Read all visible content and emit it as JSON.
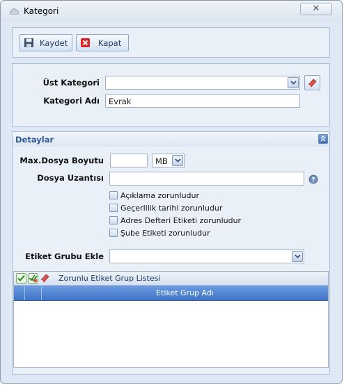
{
  "window": {
    "title": "Kategori",
    "close_glyph": "✕"
  },
  "toolbar": {
    "save_label": "Kaydet",
    "close_label": "Kapat"
  },
  "category": {
    "parent_label": "Üst Kategori",
    "parent_value": "",
    "name_label": "Kategori Adı",
    "name_value": "Evrak"
  },
  "details": {
    "header": "Detaylar",
    "max_size_label": "Max.Dosya Boyutu",
    "max_size_value": "",
    "unit_value": "MB",
    "ext_label": "Dosya Uzantısı",
    "ext_value": "",
    "checkboxes": [
      {
        "label": "Açıklama zorunludur",
        "checked": false
      },
      {
        "label": "Geçerlilik tarihi zorunludur",
        "checked": false
      },
      {
        "label": "Adres Defteri Etiketi zorunludur",
        "checked": false
      },
      {
        "label": "Şube Etiketi zorunludur",
        "checked": false
      }
    ],
    "tag_group_label": "Etiket Grubu Ekle",
    "tag_group_value": ""
  },
  "grid": {
    "title": "Zorunlu Etiket Grup Listesi",
    "column_header": "Etiket Grup Adı",
    "rows": []
  },
  "icons": [
    "cloud-icon",
    "save-icon",
    "close-x-icon",
    "eraser-icon",
    "help-icon",
    "collapse-icon",
    "check-icon",
    "check-all-icon",
    "clear-icon"
  ]
}
